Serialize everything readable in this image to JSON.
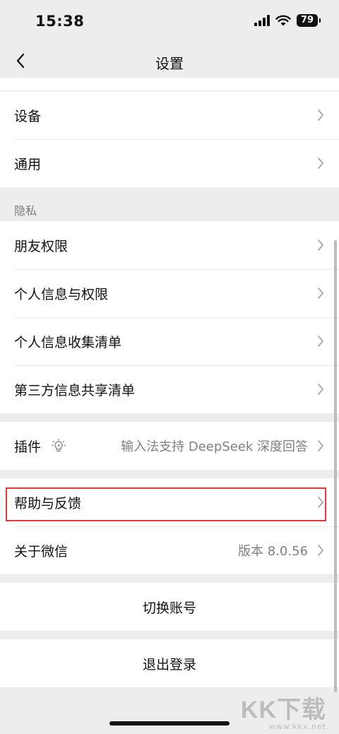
{
  "status_bar": {
    "time": "15:38",
    "battery": "79"
  },
  "nav": {
    "title": "设置"
  },
  "groups": {
    "devices": {
      "items": [
        {
          "label": "设备"
        },
        {
          "label": "通用"
        }
      ]
    },
    "privacy": {
      "header": "隐私",
      "items": [
        {
          "label": "朋友权限"
        },
        {
          "label": "个人信息与权限"
        },
        {
          "label": "个人信息收集清单"
        },
        {
          "label": "第三方信息共享清单"
        }
      ]
    },
    "plugins": {
      "label": "插件",
      "value": "输入法支持 DeepSeek 深度回答"
    },
    "help": {
      "items": [
        {
          "label": "帮助与反馈"
        },
        {
          "label": "关于微信",
          "value": "版本 8.0.56"
        }
      ]
    }
  },
  "actions": {
    "switch_account": "切换账号",
    "logout": "退出登录"
  },
  "watermark": {
    "logo": "KK下载",
    "url": "www.kkx.net"
  },
  "colors": {
    "background": "#ededed",
    "highlight": "#e53935"
  }
}
